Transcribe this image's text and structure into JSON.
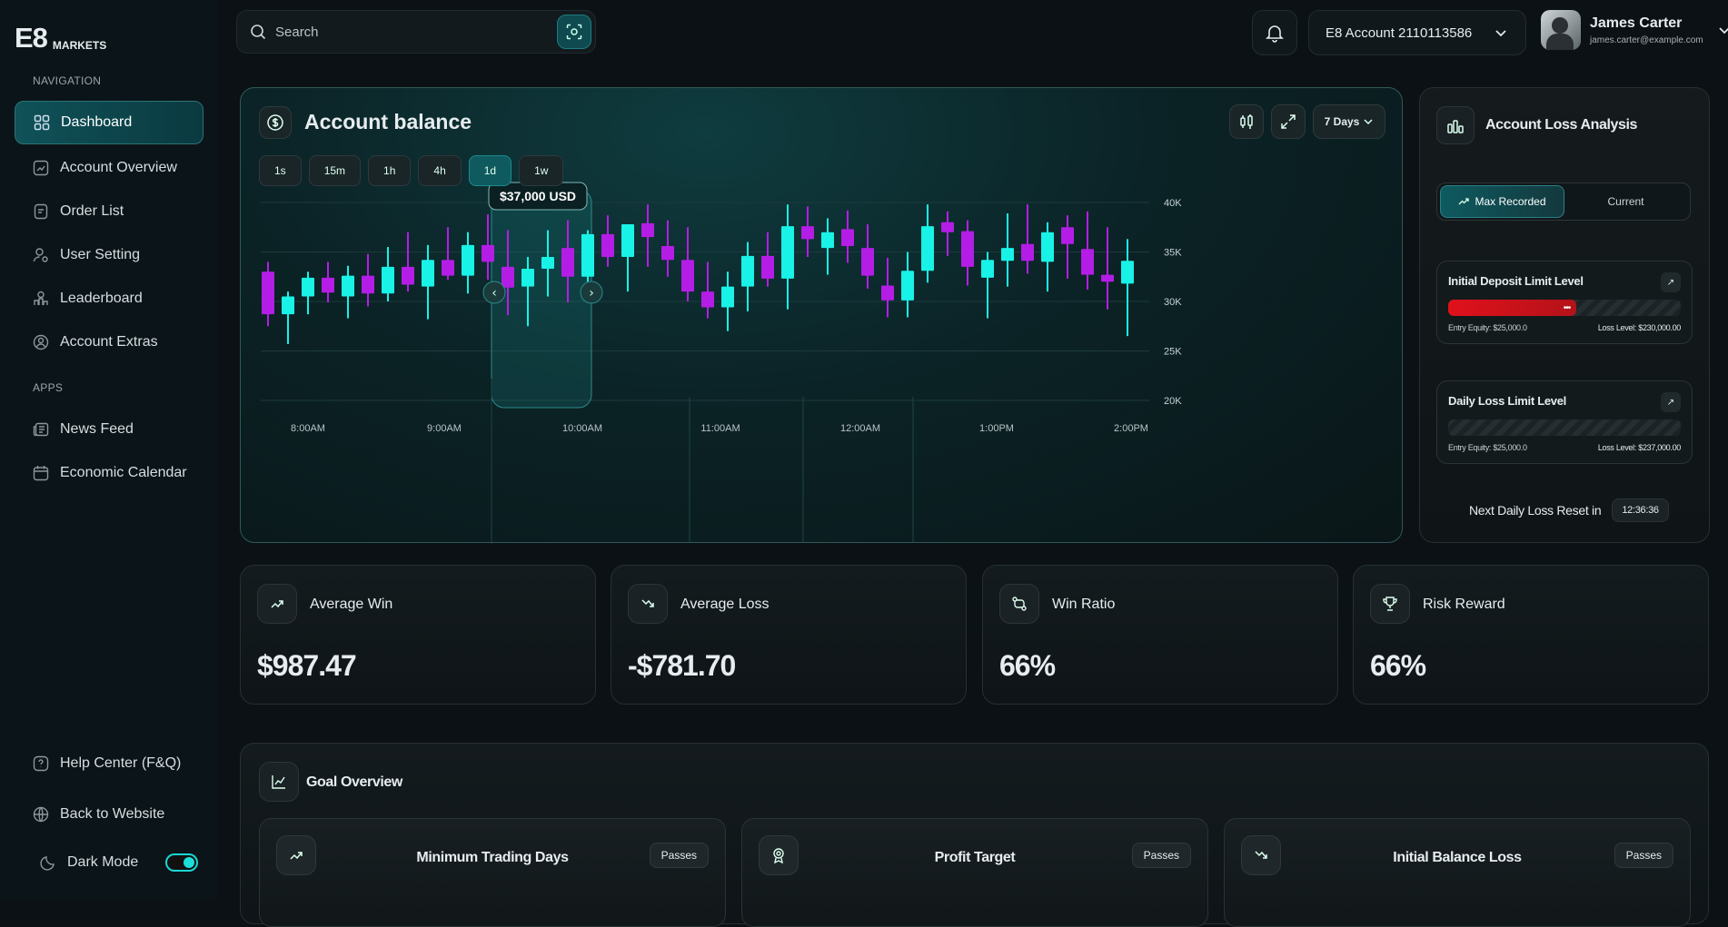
{
  "brand": {
    "big": "E8",
    "small": "MARKETS"
  },
  "sidebar": {
    "nav_heading": "NAVIGATION",
    "apps_heading": "APPS",
    "items": [
      {
        "label": "Dashboard",
        "icon": "grid-icon"
      },
      {
        "label": "Account Overview",
        "icon": "chart-icon"
      },
      {
        "label": "Order List",
        "icon": "document-icon"
      },
      {
        "label": "User Setting",
        "icon": "user-gear-icon"
      },
      {
        "label": "Leaderboard",
        "icon": "trophy-icon"
      },
      {
        "label": "Account Extras",
        "icon": "user-circle-icon"
      }
    ],
    "apps": [
      {
        "label": "News Feed",
        "icon": "newspaper-icon"
      },
      {
        "label": "Economic Calendar",
        "icon": "calendar-icon"
      }
    ],
    "bottom": [
      {
        "label": "Help Center (F&Q)",
        "icon": "help-icon"
      },
      {
        "label": "Back to Website",
        "icon": "globe-icon"
      }
    ],
    "dark_mode_label": "Dark Mode",
    "dark_mode_on": true
  },
  "header": {
    "search_placeholder": "Search",
    "account_label": "E8 Account 2110113586",
    "user_name": "James Carter",
    "user_email": "james.carter@example.com"
  },
  "balance": {
    "title": "Account balance",
    "range_label": "7 Days",
    "timeframes": [
      "1s",
      "15m",
      "1h",
      "4h",
      "1d",
      "1w"
    ],
    "active_timeframe": "1d",
    "tooltip": "$37,000 USD"
  },
  "chart_data": {
    "type": "candlestick",
    "x_labels": [
      "8:00AM",
      "9:00AM",
      "10:00AM",
      "11:00AM",
      "12:00AM",
      "1:00PM",
      "2:00PM"
    ],
    "y_ticks": [
      "40K",
      "35K",
      "30K",
      "25K",
      "20K"
    ],
    "ylim": [
      20000,
      40000
    ],
    "colors": {
      "up": "#19f2e6",
      "down": "#b41de6"
    },
    "candles": [
      {
        "o": 33000,
        "h": 34000,
        "l": 27500,
        "c": 28700
      },
      {
        "o": 28700,
        "h": 31000,
        "l": 25700,
        "c": 30500
      },
      {
        "o": 30500,
        "h": 33000,
        "l": 28700,
        "c": 32400
      },
      {
        "o": 32400,
        "h": 34000,
        "l": 29900,
        "c": 30900
      },
      {
        "o": 30500,
        "h": 33600,
        "l": 28300,
        "c": 32600
      },
      {
        "o": 32600,
        "h": 34800,
        "l": 29500,
        "c": 30800
      },
      {
        "o": 30800,
        "h": 35500,
        "l": 30000,
        "c": 33500
      },
      {
        "o": 33500,
        "h": 37000,
        "l": 31000,
        "c": 31700
      },
      {
        "o": 31500,
        "h": 35700,
        "l": 28200,
        "c": 34200
      },
      {
        "o": 34200,
        "h": 37500,
        "l": 32200,
        "c": 32600
      },
      {
        "o": 32600,
        "h": 37000,
        "l": 30800,
        "c": 35700
      },
      {
        "o": 35700,
        "h": 38800,
        "l": 32200,
        "c": 34000
      },
      {
        "o": 33500,
        "h": 37200,
        "l": 28600,
        "c": 31400
      },
      {
        "o": 31500,
        "h": 34500,
        "l": 27500,
        "c": 33300
      },
      {
        "o": 33300,
        "h": 37200,
        "l": 30500,
        "c": 34500
      },
      {
        "o": 35400,
        "h": 38200,
        "l": 29900,
        "c": 32500
      },
      {
        "o": 32500,
        "h": 37200,
        "l": 30000,
        "c": 36800
      },
      {
        "o": 36800,
        "h": 38700,
        "l": 33500,
        "c": 34500
      },
      {
        "o": 34500,
        "h": 37100,
        "l": 31000,
        "c": 37800
      },
      {
        "o": 37900,
        "h": 39800,
        "l": 33500,
        "c": 36500
      },
      {
        "o": 35600,
        "h": 38200,
        "l": 32500,
        "c": 34200
      },
      {
        "o": 34200,
        "h": 37500,
        "l": 30000,
        "c": 31000
      },
      {
        "o": 31000,
        "h": 34000,
        "l": 28300,
        "c": 29400
      },
      {
        "o": 29400,
        "h": 33000,
        "l": 27000,
        "c": 31500
      },
      {
        "o": 31500,
        "h": 36000,
        "l": 29000,
        "c": 34600
      },
      {
        "o": 34600,
        "h": 37000,
        "l": 31500,
        "c": 32300
      },
      {
        "o": 32300,
        "h": 39800,
        "l": 29200,
        "c": 37600
      },
      {
        "o": 37600,
        "h": 39600,
        "l": 34500,
        "c": 36300
      },
      {
        "o": 35400,
        "h": 38400,
        "l": 32700,
        "c": 37000
      },
      {
        "o": 37300,
        "h": 39200,
        "l": 33900,
        "c": 35600
      },
      {
        "o": 35400,
        "h": 37800,
        "l": 31300,
        "c": 32600
      },
      {
        "o": 31600,
        "h": 34400,
        "l": 28400,
        "c": 30100
      },
      {
        "o": 30100,
        "h": 35000,
        "l": 28400,
        "c": 33100
      },
      {
        "o": 33100,
        "h": 39800,
        "l": 31900,
        "c": 37600
      },
      {
        "o": 38000,
        "h": 39100,
        "l": 34600,
        "c": 37000
      },
      {
        "o": 37100,
        "h": 38200,
        "l": 31600,
        "c": 33500
      },
      {
        "o": 32400,
        "h": 35000,
        "l": 28300,
        "c": 34200
      },
      {
        "o": 34100,
        "h": 38900,
        "l": 31500,
        "c": 35400
      },
      {
        "o": 35800,
        "h": 39800,
        "l": 32800,
        "c": 34100
      },
      {
        "o": 34000,
        "h": 38000,
        "l": 31000,
        "c": 37000
      },
      {
        "o": 37500,
        "h": 38700,
        "l": 32300,
        "c": 35800
      },
      {
        "o": 35300,
        "h": 39100,
        "l": 31200,
        "c": 32700
      },
      {
        "o": 32700,
        "h": 37500,
        "l": 29200,
        "c": 32000
      },
      {
        "o": 31800,
        "h": 36300,
        "l": 26500,
        "c": 34100
      }
    ]
  },
  "loss": {
    "title": "Account Loss Analysis",
    "seg_max": "Max Recorded",
    "seg_current": "Current",
    "initial": {
      "title": "Initial Deposit Limit Level",
      "entry": "Entry Equity: $25,000.0",
      "loss": "Loss Level: $230,000.00",
      "progress": 0.55
    },
    "daily": {
      "title": "Daily Loss Limit Level",
      "entry": "Entry Equity: $25,000.0",
      "loss": "Loss Level: $237,000.00",
      "progress": 0.0
    },
    "reset_label": "Next Daily Loss Reset in",
    "reset_time": "12:36:36"
  },
  "stats": [
    {
      "label": "Average Win",
      "value": "$987.47",
      "icon": "trend-up-icon"
    },
    {
      "label": "Average Loss",
      "value": "-$781.70",
      "icon": "trend-down-icon"
    },
    {
      "label": "Win Ratio",
      "value": "66%",
      "icon": "ratio-icon"
    },
    {
      "label": "Risk Reward",
      "value": "66%",
      "icon": "trophy-icon"
    }
  ],
  "goal": {
    "title": "Goal Overview",
    "cards": [
      {
        "title": "Minimum Trading Days",
        "status": "Passes",
        "icon": "trend-up-icon"
      },
      {
        "title": "Profit Target",
        "status": "Passes",
        "icon": "target-icon"
      },
      {
        "title": "Initial Balance Loss",
        "status": "Passes",
        "icon": "trend-down-icon"
      }
    ]
  }
}
